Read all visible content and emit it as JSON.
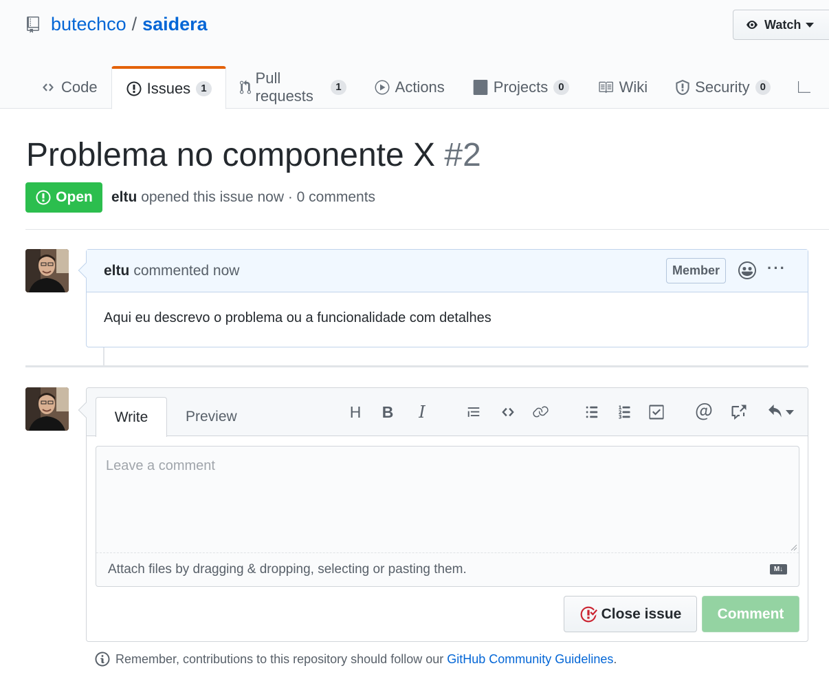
{
  "repo": {
    "owner": "butechco",
    "separator": "/",
    "name": "saidera"
  },
  "watch": {
    "label": "Watch"
  },
  "tabs": [
    {
      "label": "Code",
      "icon": "code-icon"
    },
    {
      "label": "Issues",
      "icon": "issue-opened-icon",
      "count": "1"
    },
    {
      "label": "Pull requests",
      "icon": "git-pull-request-icon",
      "count": "1"
    },
    {
      "label": "Actions",
      "icon": "play-icon"
    },
    {
      "label": "Projects",
      "icon": "project-icon",
      "count": "0"
    },
    {
      "label": "Wiki",
      "icon": "book-icon"
    },
    {
      "label": "Security",
      "icon": "shield-icon",
      "count": "0"
    }
  ],
  "issue": {
    "title": "Problema no componente X",
    "number": "#2",
    "state": "Open",
    "author": "eltu",
    "meta": "opened this issue now · 0 comments"
  },
  "comment": {
    "author": "eltu",
    "when": "commented now",
    "role": "Member",
    "more": "···",
    "body": "Aqui eu descrevo o problema ou a funcionalidade com detalhes"
  },
  "composer": {
    "write_tab": "Write",
    "preview_tab": "Preview",
    "toolbar": {
      "heading": "H",
      "bold": "B",
      "italic": "I"
    },
    "placeholder": "Leave a comment",
    "attach_text": "Attach files by dragging & dropping, selecting or pasting them.",
    "markdown_badge": "M↓",
    "close_label": "Close issue",
    "comment_label": "Comment"
  },
  "footer": {
    "text": "Remember, contributions to this repository should follow our",
    "link": "GitHub Community Guidelines",
    "end": "."
  },
  "colors": {
    "accent": "#0366d6",
    "open": "#2cbe4e",
    "tab_active": "#e36209",
    "close_icon": "#cb2431"
  }
}
